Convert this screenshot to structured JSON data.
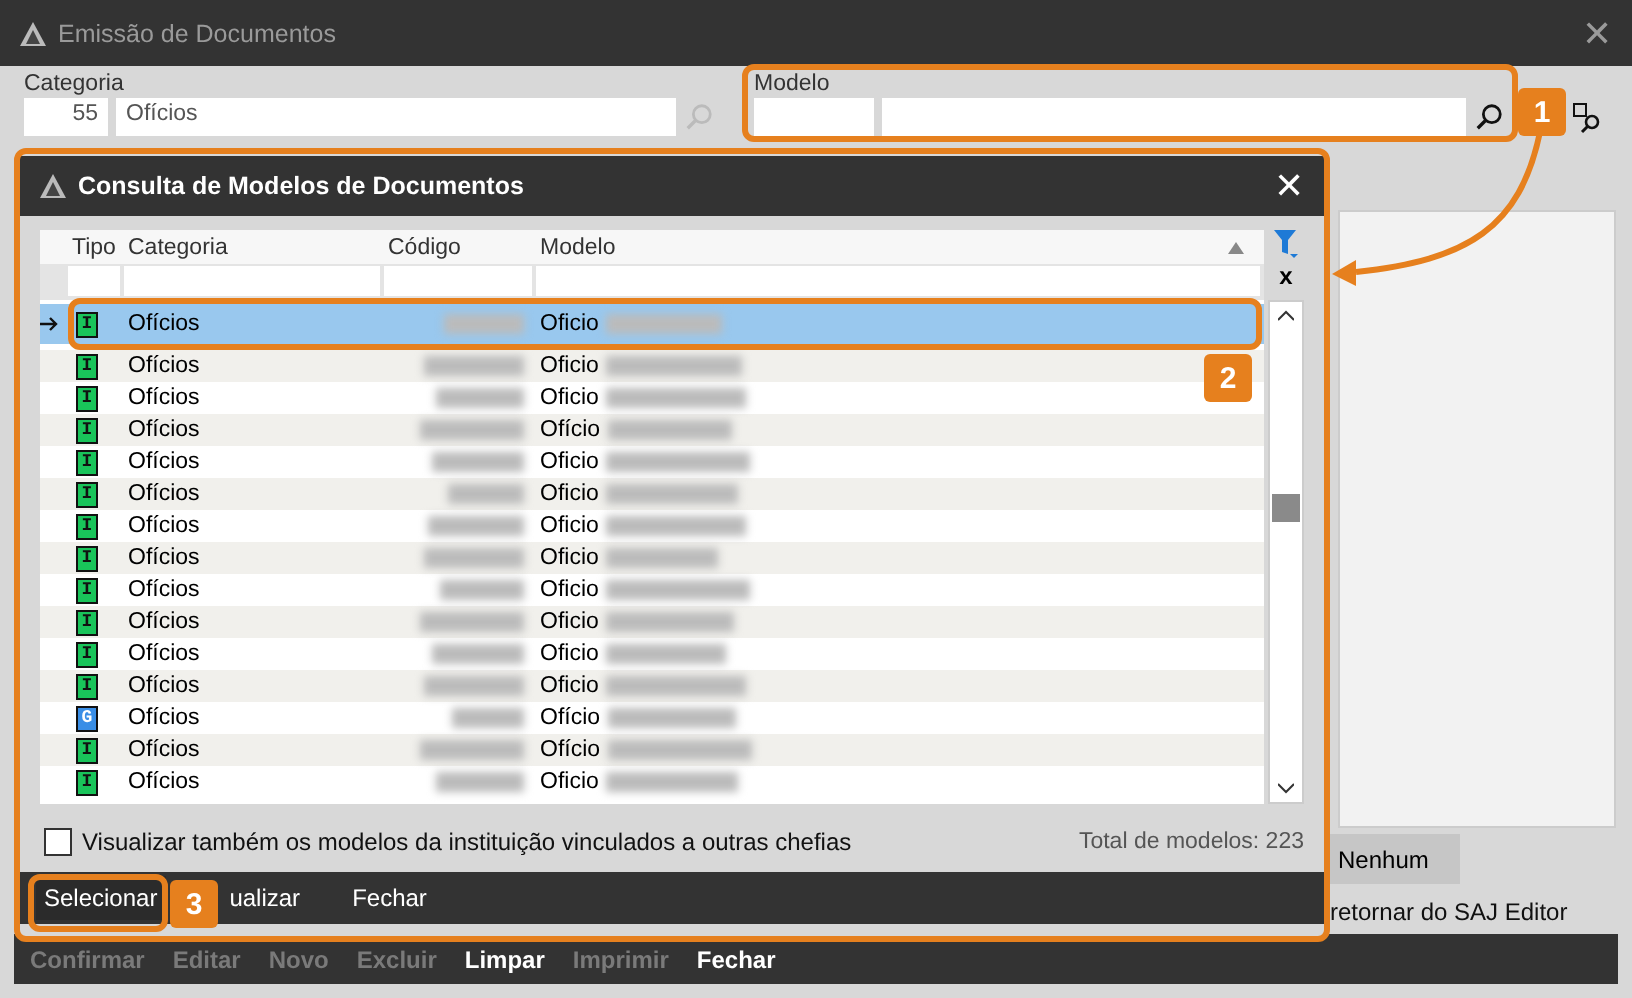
{
  "window": {
    "title": "Emissão de Documentos",
    "close": "✕"
  },
  "categoria": {
    "label": "Categoria",
    "code": "55",
    "name": "Ofícios"
  },
  "modelo": {
    "label": "Modelo"
  },
  "side": {
    "button": "Nenhum",
    "note": "retornar do SAJ Editor"
  },
  "toolbar": [
    {
      "label": "Confirmar",
      "disabled": true
    },
    {
      "label": "Editar",
      "disabled": true
    },
    {
      "label": "Novo",
      "disabled": true
    },
    {
      "label": "Excluir",
      "disabled": true
    },
    {
      "label": "Limpar",
      "disabled": false
    },
    {
      "label": "Imprimir",
      "disabled": true
    },
    {
      "label": "Fechar",
      "disabled": false
    }
  ],
  "dialog": {
    "title": "Consulta de Modelos de Documentos",
    "close": "✕",
    "columns": [
      "Tipo",
      "Categoria",
      "Código",
      "Modelo"
    ],
    "clear_filter": "x",
    "rows": [
      {
        "kind": "I",
        "category": "Ofícios",
        "model": "Oficio",
        "selected": true
      },
      {
        "kind": "I",
        "category": "Ofícios",
        "model": "Oficio",
        "selected": false
      },
      {
        "kind": "I",
        "category": "Ofícios",
        "model": "Oficio",
        "selected": false
      },
      {
        "kind": "I",
        "category": "Ofícios",
        "model": "Ofício",
        "selected": false
      },
      {
        "kind": "I",
        "category": "Ofícios",
        "model": "Oficio",
        "selected": false
      },
      {
        "kind": "I",
        "category": "Ofícios",
        "model": "Oficio",
        "selected": false
      },
      {
        "kind": "I",
        "category": "Ofícios",
        "model": "Oficio",
        "selected": false
      },
      {
        "kind": "I",
        "category": "Ofícios",
        "model": "Oficio",
        "selected": false
      },
      {
        "kind": "I",
        "category": "Ofícios",
        "model": "Oficio",
        "selected": false
      },
      {
        "kind": "I",
        "category": "Ofícios",
        "model": "Oficio",
        "selected": false
      },
      {
        "kind": "I",
        "category": "Ofícios",
        "model": "Oficio",
        "selected": false
      },
      {
        "kind": "I",
        "category": "Ofícios",
        "model": "Oficio",
        "selected": false
      },
      {
        "kind": "G",
        "category": "Ofícios",
        "model": "Ofício",
        "selected": false
      },
      {
        "kind": "I",
        "category": "Ofícios",
        "model": "Ofício",
        "selected": false
      },
      {
        "kind": "I",
        "category": "Ofícios",
        "model": "Oficio",
        "selected": false
      }
    ],
    "checkbox": {
      "label": "Visualizar também os modelos da instituição vinculados a outras chefias",
      "checked": false
    },
    "total": "Total de modelos: 223",
    "buttons": [
      "Selecionar",
      "ualizar",
      "Fechar"
    ]
  },
  "annotations": [
    "1",
    "2",
    "3"
  ]
}
